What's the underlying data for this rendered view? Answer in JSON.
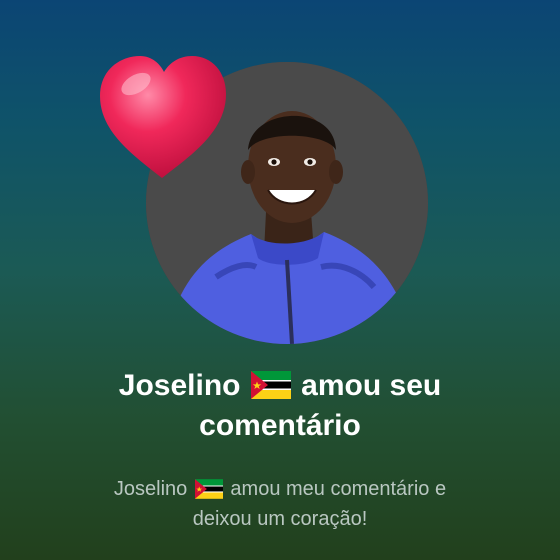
{
  "notification": {
    "user_name": "Joselino",
    "flag_icon": "mozambique-flag-icon",
    "headline_action": "amou seu",
    "headline_object": "comentário",
    "subtext_action": "amou meu comentário e",
    "subtext_tail": "deixou um coração!"
  },
  "icons": {
    "reaction": "heart-icon",
    "avatar": "user-avatar"
  },
  "colors": {
    "gradient_top": "#0b4574",
    "gradient_bottom": "#22401c",
    "heart": "#f0285a",
    "headline_text": "#ffffff",
    "subtext": "#b9c7c1"
  }
}
